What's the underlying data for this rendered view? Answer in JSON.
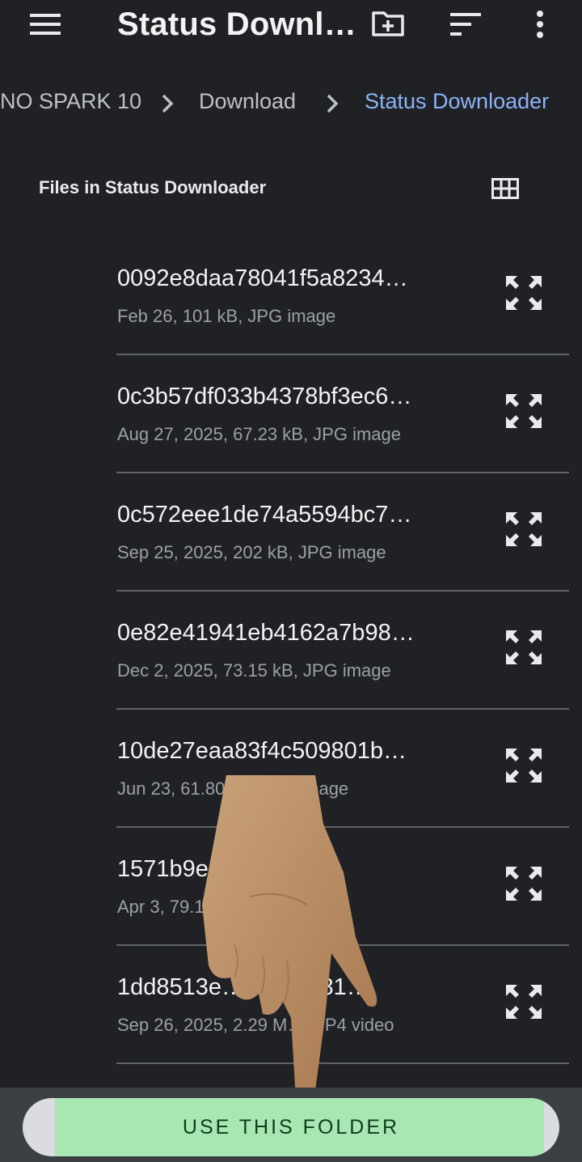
{
  "appbar": {
    "title": "Status Downl…",
    "menu_icon": "hamburger-menu-icon",
    "new_folder_icon": "new-folder-icon",
    "sort_icon": "sort-icon",
    "more_icon": "more-vert-icon"
  },
  "breadcrumb": {
    "items": [
      "NO SPARK 10",
      "Download",
      "Status Downloader"
    ]
  },
  "section": {
    "title": "Files in Status Downloader"
  },
  "files": [
    {
      "name": "0092e8daa78041f5a8234…",
      "meta": "Feb 26, 101 kB, JPG image"
    },
    {
      "name": "0c3b57df033b4378bf3ec6…",
      "meta": "Aug 27, 2025, 67.23 kB, JPG image"
    },
    {
      "name": "0c572eee1de74a5594bc7…",
      "meta": "Sep 25, 2025, 202 kB, JPG image"
    },
    {
      "name": "0e82e41941eb4162a7b98…",
      "meta": "Dec 2, 2025, 73.15 kB, JPG image"
    },
    {
      "name": "10de27eaa83f4c509801b…",
      "meta": "Jun 23, 61.80 kB, JPG image"
    },
    {
      "name": "1571b9e…bdcf5…",
      "meta": "Apr 3, 79.1…"
    },
    {
      "name": "1dd8513e…549…481…",
      "meta": "Sep 26, 2025, 2.29 M… MP4 video"
    }
  ],
  "bottom": {
    "use_folder_label": "USE THIS FOLDER"
  },
  "colors": {
    "background": "#202124",
    "accent_blue": "#8ab4f8",
    "button_green": "#a8e6b2",
    "bottom_bar": "#3c4043"
  }
}
